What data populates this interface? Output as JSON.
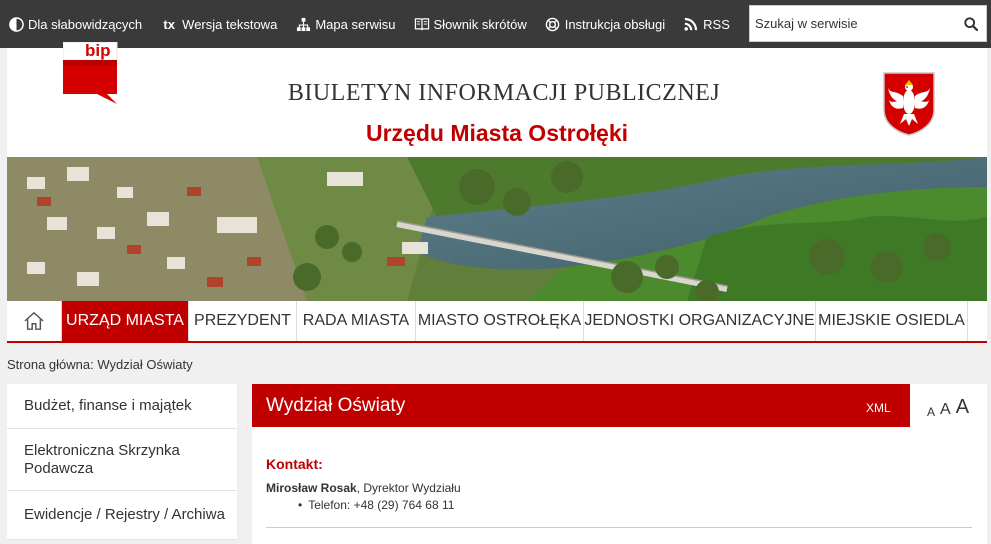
{
  "topbar": {
    "links": [
      {
        "label": "Dla słabowidzących",
        "icon": "contrast-icon"
      },
      {
        "label": "Wersja tekstowa",
        "icon": "text-version-icon"
      },
      {
        "label": "Mapa serwisu",
        "icon": "sitemap-icon"
      },
      {
        "label": "Słownik skrótów",
        "icon": "book-icon"
      },
      {
        "label": "Instrukcja obsługi",
        "icon": "lifebuoy-icon"
      },
      {
        "label": "RSS",
        "icon": "rss-icon"
      }
    ],
    "text_icon_glyph": "tx",
    "search": {
      "placeholder": "Szukaj w serwisie",
      "value": ""
    }
  },
  "header": {
    "logo_text": "bip",
    "title_line1": "BIULETYN INFORMACJI PUBLICZNEJ",
    "title_line2": "Urzędu Miasta Ostrołęki"
  },
  "nav": {
    "items": [
      {
        "label": "URZĄD MIASTA",
        "active": true
      },
      {
        "label": "PREZYDENT",
        "active": false
      },
      {
        "label": "RADA MIASTA",
        "active": false
      },
      {
        "label": "MIASTO OSTROŁĘKA",
        "active": false
      },
      {
        "label": "JEDNOSTKI ORGANIZACYJNE",
        "active": false
      },
      {
        "label": "MIEJSKIE OSIEDLA",
        "active": false
      }
    ]
  },
  "breadcrumb": "Strona główna: Wydział Oświaty",
  "sidebar": {
    "items": [
      {
        "label": "Budżet, finanse i majątek"
      },
      {
        "label": "Elektroniczna Skrzynka Podawcza"
      },
      {
        "label": "Ewidencje / Rejestry / Archiwa"
      }
    ]
  },
  "content": {
    "title": "Wydział Oświaty",
    "xml_label": "XML",
    "font_sizes": [
      "A",
      "A",
      "A"
    ],
    "kontakt_label": "Kontakt:",
    "person_name": "Mirosław Rosak",
    "person_role": ", Dyrektor Wydziału",
    "phone": "Telefon: +48 (29) 764 68 11"
  },
  "colors": {
    "accent": "#c00000",
    "topbar": "#3a3a3a",
    "background": "#f0f0f0"
  }
}
